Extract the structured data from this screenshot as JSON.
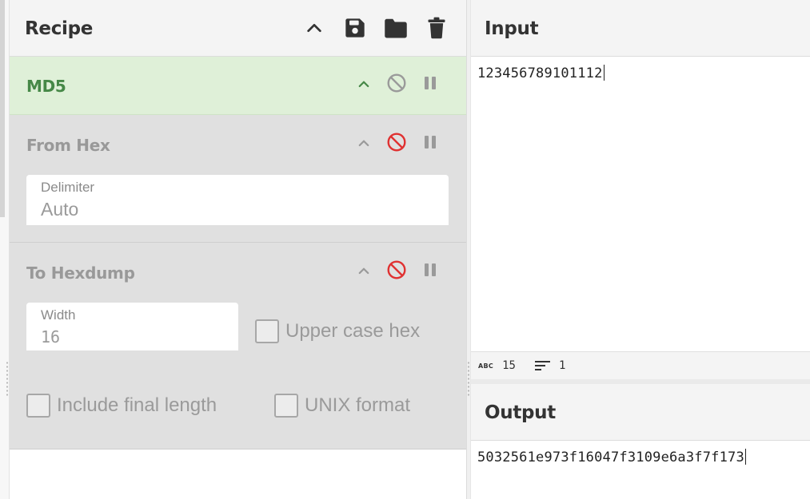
{
  "recipe": {
    "title": "Recipe",
    "icons": [
      "chevron-up-icon",
      "save-icon",
      "folder-icon",
      "trash-icon"
    ]
  },
  "operations": [
    {
      "name": "MD5",
      "state": "active"
    },
    {
      "name": "From Hex",
      "state": "disabled",
      "fields": {
        "delimiter_label": "Delimiter",
        "delimiter_value": "Auto"
      }
    },
    {
      "name": "To Hexdump",
      "state": "disabled",
      "fields": {
        "width_label": "Width",
        "width_value": "16"
      },
      "checkboxes": [
        "Upper case hex",
        "Include final length",
        "UNIX format"
      ]
    }
  ],
  "input": {
    "title": "Input",
    "text": "123456789101112",
    "status": {
      "length": "15",
      "lines": "1"
    }
  },
  "output": {
    "title": "Output",
    "text": "5032561e973f16047f3109e6a3f7f173"
  },
  "colors": {
    "active_op_bg": "#dff0d8",
    "active_op_text": "#468847",
    "disabled_op_bg": "#e0e0e0",
    "disable_icon_red": "#e03131"
  }
}
